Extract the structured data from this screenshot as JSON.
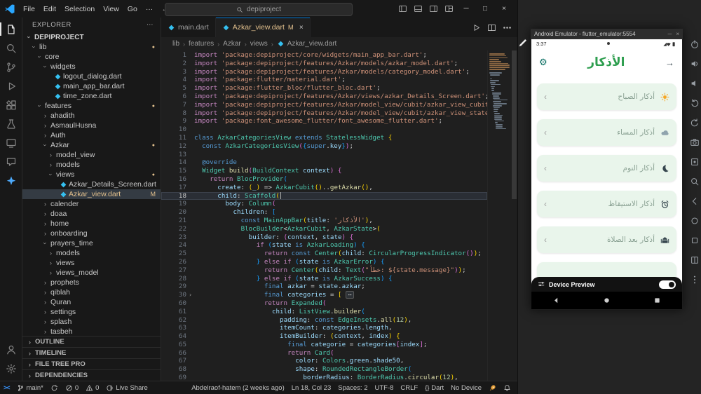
{
  "titlebar": {
    "menus": [
      "File",
      "Edit",
      "Selection",
      "View",
      "Go"
    ],
    "menu_overflow": "···",
    "search_value": "depiproject",
    "layout_icons": [
      "toggle-sidebar-icon",
      "toggle-panel-icon",
      "toggle-secondary-sidebar-icon",
      "customize-layout-icon"
    ],
    "window_controls": [
      "minimize",
      "maximize",
      "close"
    ]
  },
  "activity_bar": {
    "top": [
      "explorer",
      "search",
      "source-control",
      "run-debug",
      "extensions",
      "testing",
      "remote-explorer",
      "chat",
      "copilot"
    ],
    "bottom": [
      "account",
      "settings"
    ],
    "active": "explorer"
  },
  "explorer": {
    "title": "EXPLORER",
    "project": "DEPIPROJECT",
    "tree": [
      {
        "label": "lib",
        "kind": "open",
        "level": 0,
        "dot": true
      },
      {
        "label": "core",
        "kind": "open",
        "level": 1
      },
      {
        "label": "widgets",
        "kind": "open",
        "level": 2
      },
      {
        "label": "logout_dialog.dart",
        "kind": "file",
        "level": 3
      },
      {
        "label": "main_app_bar.dart",
        "kind": "file",
        "level": 3
      },
      {
        "label": "time_zone.dart",
        "kind": "file",
        "level": 3
      },
      {
        "label": "features",
        "kind": "open",
        "level": 1,
        "dot": true
      },
      {
        "label": "ahadith",
        "kind": "closed",
        "level": 2
      },
      {
        "label": "AsmaulHusna",
        "kind": "closed",
        "level": 2
      },
      {
        "label": "Auth",
        "kind": "closed",
        "level": 2
      },
      {
        "label": "Azkar",
        "kind": "open",
        "level": 2,
        "dot": true
      },
      {
        "label": "model_view",
        "kind": "closed",
        "level": 3
      },
      {
        "label": "models",
        "kind": "closed",
        "level": 3
      },
      {
        "label": "views",
        "kind": "open",
        "level": 3,
        "dot": true
      },
      {
        "label": "Azkar_Details_Screen.dart",
        "kind": "file",
        "level": 4
      },
      {
        "label": "Azkar_view.dart",
        "kind": "file",
        "level": 4,
        "selected": true,
        "modified": true,
        "badge": "M"
      },
      {
        "label": "calender",
        "kind": "closed",
        "level": 2
      },
      {
        "label": "doaa",
        "kind": "closed",
        "level": 2
      },
      {
        "label": "home",
        "kind": "closed",
        "level": 2
      },
      {
        "label": "onboarding",
        "kind": "closed",
        "level": 2
      },
      {
        "label": "prayers_time",
        "kind": "open",
        "level": 2
      },
      {
        "label": "models",
        "kind": "closed",
        "level": 3
      },
      {
        "label": "views",
        "kind": "closed",
        "level": 3
      },
      {
        "label": "views_model",
        "kind": "closed",
        "level": 3
      },
      {
        "label": "prophets",
        "kind": "closed",
        "level": 2
      },
      {
        "label": "qiblah",
        "kind": "closed",
        "level": 2
      },
      {
        "label": "Quran",
        "kind": "closed",
        "level": 2
      },
      {
        "label": "settings",
        "kind": "closed",
        "level": 2
      },
      {
        "label": "splash",
        "kind": "closed",
        "level": 2
      },
      {
        "label": "tasbeh",
        "kind": "closed",
        "level": 2
      }
    ],
    "sections": [
      "OUTLINE",
      "TIMELINE",
      "FILE TREE PRO",
      "DEPENDENCIES"
    ]
  },
  "editor": {
    "tabs": [
      {
        "label": "main.dart",
        "active": false,
        "modified": false,
        "badge": ""
      },
      {
        "label": "Azkar_view.dart",
        "active": true,
        "modified": true,
        "badge": "M"
      }
    ],
    "breadcrumb": [
      "lib",
      "features",
      "Azkar",
      "views",
      "Azkar_view.dart"
    ],
    "code": {
      "current_line": 18,
      "lines": [
        {
          "n": 1,
          "t": "import 'package:depiproject/core/widgets/main_app_bar.dart';"
        },
        {
          "n": 2,
          "t": "import 'package:depiproject/features/Azkar/models/azkar_model.dart';"
        },
        {
          "n": 3,
          "t": "import 'package:depiproject/features/Azkar/models/category_model.dart';"
        },
        {
          "n": 4,
          "t": "import 'package:flutter/material.dart';"
        },
        {
          "n": 5,
          "t": "import 'package:flutter_bloc/flutter_bloc.dart';"
        },
        {
          "n": 6,
          "t": "import 'package:depiproject/features/Azkar/views/azkar_Details_Screen.dart';"
        },
        {
          "n": 7,
          "t": "import 'package:depiproject/features/Azkar/model_view/cubit/azkar_view_cubit.dart';"
        },
        {
          "n": 8,
          "t": "import 'package:depiproject/features/Azkar/model_view/cubit/azkar_view_state.dart';"
        },
        {
          "n": 9,
          "t": "import 'package:font_awesome_flutter/font_awesome_flutter.dart';"
        },
        {
          "n": 10,
          "t": ""
        },
        {
          "n": 11,
          "t": "class AzkarCategoriesView extends StatelessWidget {"
        },
        {
          "n": 12,
          "t": "  const AzkarCategoriesView({super.key});"
        },
        {
          "n": 13,
          "t": ""
        },
        {
          "n": 14,
          "t": "  @override"
        },
        {
          "n": 15,
          "t": "  Widget build(BuildContext context) {"
        },
        {
          "n": 16,
          "t": "    return BlocProvider("
        },
        {
          "n": 17,
          "t": "      create: (_) => AzkarCubit()..getAzkar(),"
        },
        {
          "n": 18,
          "t": "      child: Scaffold("
        },
        {
          "n": 19,
          "t": "        body: Column("
        },
        {
          "n": 20,
          "t": "          children: ["
        },
        {
          "n": 21,
          "t": "            const MainAppBar(title: 'الأذكار'),"
        },
        {
          "n": 22,
          "t": "            BlocBuilder<AzkarCubit, AzkarState>("
        },
        {
          "n": 23,
          "t": "              builder: (context, state) {"
        },
        {
          "n": 24,
          "t": "                if (state is AzkarLoading) {"
        },
        {
          "n": 25,
          "t": "                  return const Center(child: CircularProgressIndicator());"
        },
        {
          "n": 26,
          "t": "                } else if (state is AzkarError) {"
        },
        {
          "n": 27,
          "t": "                  return Center(child: Text(\"خطأ: ${state.message}\"));"
        },
        {
          "n": 28,
          "t": "                } else if (state is AzkarSuccess) {"
        },
        {
          "n": 29,
          "t": "                  final azkar = state.azkar;"
        },
        {
          "n": 30,
          "t": "                  final categories = [",
          "fold": true
        },
        {
          "n": 60,
          "t": "                  return Expanded("
        },
        {
          "n": 61,
          "t": "                    child: ListView.builder("
        },
        {
          "n": 62,
          "t": "                      padding: const EdgeInsets.all(12),"
        },
        {
          "n": 63,
          "t": "                      itemCount: categories.length,"
        },
        {
          "n": 64,
          "t": "                      itemBuilder: (context, index) {"
        },
        {
          "n": 65,
          "t": "                        final categorie = categories[index];"
        },
        {
          "n": 66,
          "t": "                        return Card("
        },
        {
          "n": 67,
          "t": "                          color: Colors.green.shade50,"
        },
        {
          "n": 68,
          "t": "                          shape: RoundedRectangleBorder("
        },
        {
          "n": 69,
          "t": "                            borderRadius: BorderRadius.circular(12),"
        }
      ]
    }
  },
  "statusbar": {
    "left": [
      {
        "name": "remote-indicator",
        "icon": "remote",
        "label": ""
      },
      {
        "name": "git-branch",
        "icon": "branch",
        "label": "main*"
      },
      {
        "name": "sync-changes",
        "icon": "sync",
        "label": ""
      },
      {
        "name": "errors",
        "icon": "error",
        "label": "0"
      },
      {
        "name": "warnings",
        "icon": "warning",
        "label": "0"
      },
      {
        "name": "live-share",
        "icon": "liveshare",
        "label": "Live Share"
      }
    ],
    "right": [
      {
        "name": "git-blame",
        "icon": "",
        "label": "Abdelraof-hatem (2 weeks ago)"
      },
      {
        "name": "cursor-position",
        "icon": "",
        "label": "Ln 18, Col 23"
      },
      {
        "name": "indentation",
        "icon": "",
        "label": "Spaces: 2"
      },
      {
        "name": "encoding",
        "icon": "",
        "label": "UTF-8"
      },
      {
        "name": "eol",
        "icon": "",
        "label": "CRLF"
      },
      {
        "name": "language-mode",
        "icon": "",
        "label": "{} Dart"
      },
      {
        "name": "device-selector",
        "icon": "",
        "label": "No Device"
      },
      {
        "name": "rocket",
        "icon": "rocket",
        "label": ""
      },
      {
        "name": "notifications",
        "icon": "bell",
        "label": ""
      }
    ]
  },
  "emulator": {
    "window_title": "Android Emulator - flutter_emulator:5554",
    "phone": {
      "time": "3:37",
      "app_title": "الأذكار",
      "cards": [
        {
          "label": "أذكار الصباح",
          "icon": "sun"
        },
        {
          "label": "أذكار المساء",
          "icon": "cloud-moon"
        },
        {
          "label": "أذكار النوم",
          "icon": "moon"
        },
        {
          "label": "أذكار الاستيقاظ",
          "icon": "alarm"
        },
        {
          "label": "أذكار بعد الصلاة",
          "icon": "mosque"
        }
      ],
      "partial_card": true,
      "device_preview": {
        "label": "Device Preview",
        "on": true
      }
    },
    "nav_buttons": [
      "back",
      "home",
      "recents"
    ],
    "side_toolbar": [
      "power",
      "volume-up",
      "volume-down",
      "rotate-left",
      "rotate-right",
      "camera",
      "screenshot",
      "zoom",
      "back",
      "home",
      "overview",
      "fold",
      "more"
    ]
  },
  "colors": {
    "app_green": "#2e9e4f",
    "card_bg": "#e9f5eb",
    "accent_blue": "#0078d4",
    "modified_yellow": "#e2c08d"
  }
}
